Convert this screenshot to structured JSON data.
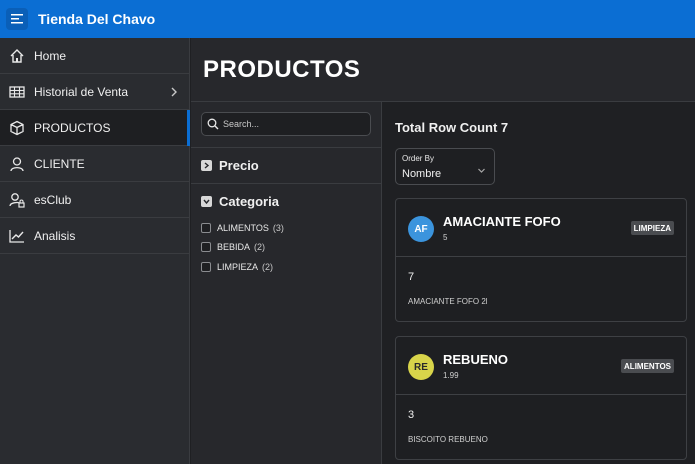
{
  "app": {
    "title": "Tienda Del Chavo",
    "accent": "#0b6ed3"
  },
  "sidebar": {
    "items": [
      {
        "label": "Home",
        "icon": "home-icon"
      },
      {
        "label": "Historial de Venta",
        "icon": "table-icon"
      },
      {
        "label": "PRODUCTOS",
        "icon": "box-icon"
      },
      {
        "label": "CLIENTE",
        "icon": "user-icon"
      },
      {
        "label": "esClub",
        "icon": "user-lock-icon"
      },
      {
        "label": "Analisis",
        "icon": "chart-line-icon"
      }
    ]
  },
  "page": {
    "title": "PRODUCTOS"
  },
  "search": {
    "placeholder": "Search..."
  },
  "facets": {
    "precio": {
      "label": "Precio"
    },
    "categoria": {
      "label": "Categoria",
      "options": [
        {
          "label": "ALIMENTOS",
          "count": "(3)"
        },
        {
          "label": "BEBIDA",
          "count": "(2)"
        },
        {
          "label": "LIMPIEZA",
          "count": "(2)"
        }
      ]
    }
  },
  "results": {
    "row_count": "Total Row Count 7",
    "order_by": {
      "label": "Order By",
      "value": "Nombre"
    },
    "cards": [
      {
        "initials": "AF",
        "title": "AMACIANTE FOFO",
        "price": "5",
        "badge": "LIMPIEZA",
        "qty": "7",
        "desc": "AMACIANTE FOFO 2l",
        "avatar_color": "#3b94dd",
        "avatar_text": "#ffffff"
      },
      {
        "initials": "RE",
        "title": "REBUENO",
        "price": "1.99",
        "badge": "ALIMENTOS",
        "qty": "3",
        "desc": "BISCOITO REBUENO",
        "avatar_color": "#d8d44a",
        "avatar_text": "#2a2a2a"
      }
    ]
  }
}
